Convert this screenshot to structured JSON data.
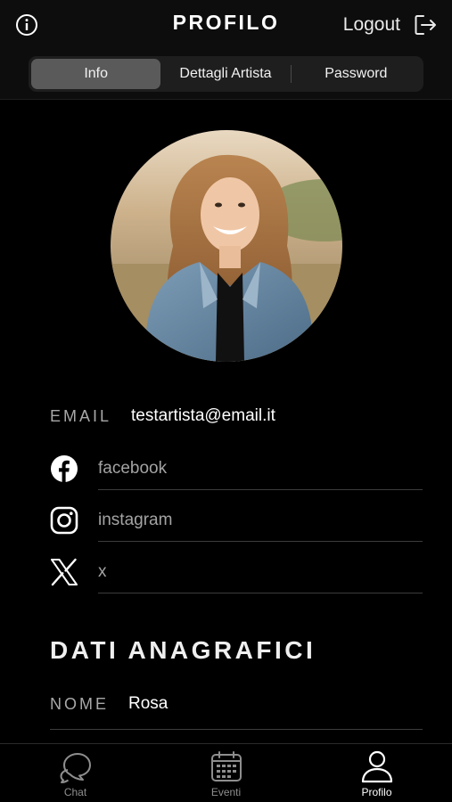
{
  "header": {
    "title": "PROFILO",
    "logout_label": "Logout",
    "info_icon": "info-icon",
    "logout_icon": "logout-icon"
  },
  "segments": {
    "items": [
      {
        "label": "Info",
        "active": true
      },
      {
        "label": "Dettagli Artista",
        "active": false
      },
      {
        "label": "Password",
        "active": false
      }
    ]
  },
  "profile": {
    "email_label": "EMAIL",
    "email_value": "testartista@email.it",
    "social": [
      {
        "icon": "facebook-icon",
        "placeholder": "facebook"
      },
      {
        "icon": "instagram-icon",
        "placeholder": "instagram"
      },
      {
        "icon": "x-icon",
        "placeholder": "x"
      }
    ]
  },
  "anagrafica": {
    "section_title": "DATI ANAGRAFICI",
    "nome_label": "NOME",
    "nome_value": "Rosa"
  },
  "tabbar": {
    "items": [
      {
        "label": "Chat",
        "icon": "chat-icon",
        "active": false
      },
      {
        "label": "Eventi",
        "icon": "calendar-icon",
        "active": false
      },
      {
        "label": "Profilo",
        "icon": "user-icon",
        "active": true
      }
    ]
  },
  "colors": {
    "background": "#000000",
    "header_bg": "#0d0d0d",
    "segment_bg": "#1e1e1e",
    "segment_active": "#5a5a5a",
    "muted_text": "#a8a8a8"
  }
}
